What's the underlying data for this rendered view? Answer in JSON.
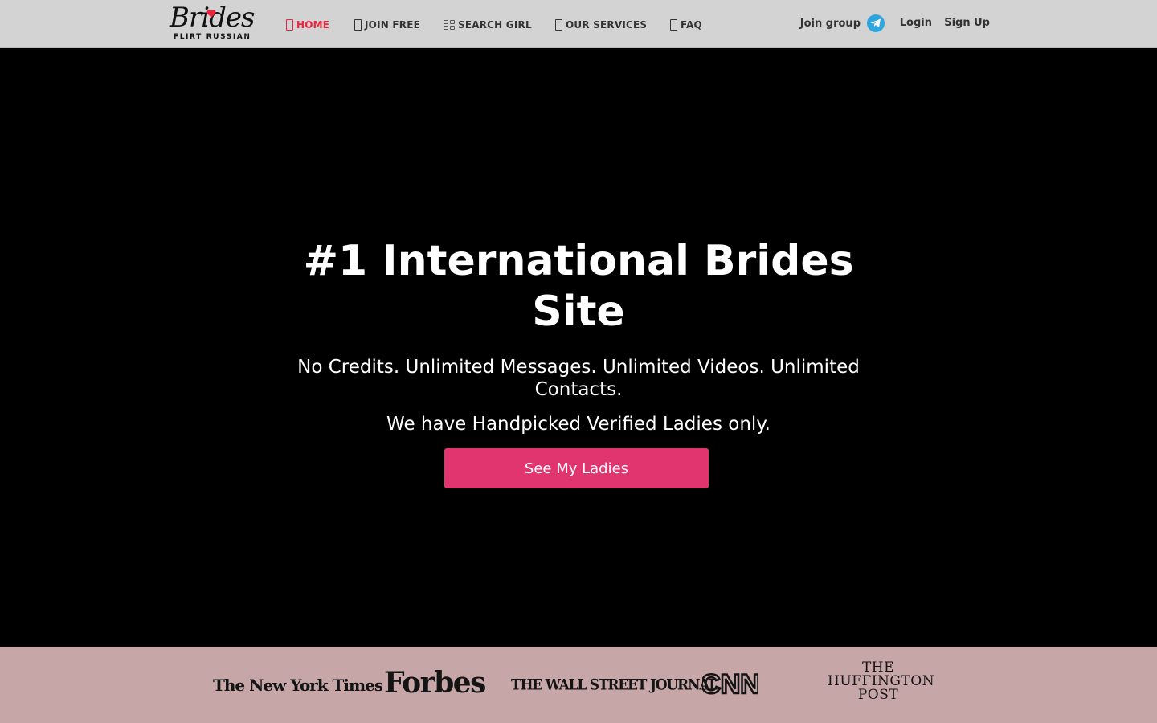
{
  "brand": {
    "name": "Brides",
    "tagline": "FLIRT RUSSIAN",
    "accent": "#e8253f"
  },
  "nav": {
    "items": [
      {
        "label": "HOME",
        "icon": "home-icon",
        "active": true
      },
      {
        "label": "JOIN FREE",
        "icon": "user-plus-icon",
        "active": false
      },
      {
        "label": "SEARCH GIRL",
        "icon": "grid-icon",
        "active": false
      },
      {
        "label": "OUR SERVICES",
        "icon": "services-icon",
        "active": false
      },
      {
        "label": "FAQ",
        "icon": "question-icon",
        "active": false
      }
    ]
  },
  "right_nav": {
    "join_group": "Join group",
    "login": "Login",
    "signup": "Sign Up"
  },
  "hero": {
    "title": "#1 International Brides Site",
    "subtitle": "No Credits. Unlimited Messages. Unlimited Videos. Unlimited Contacts.",
    "subtitle2": "We have Handpicked Verified Ladies only.",
    "cta_label": "See My Ladies",
    "cta_color": "#e0356e"
  },
  "press": {
    "logos": [
      "The New York Times",
      "Forbes",
      "THE WALL STREET JOURNAL.",
      "CNN",
      "THE HUFFINGTON POST"
    ],
    "nyt": "The New York Times",
    "forbes": "Forbes",
    "wsj": "THE WALL STREET JOURNAL.",
    "cnn": "CNN",
    "huff_line1": "THE",
    "huff_line2": "HUFFINGTON",
    "huff_line3": "POST",
    "background": "#c7a6a8"
  }
}
